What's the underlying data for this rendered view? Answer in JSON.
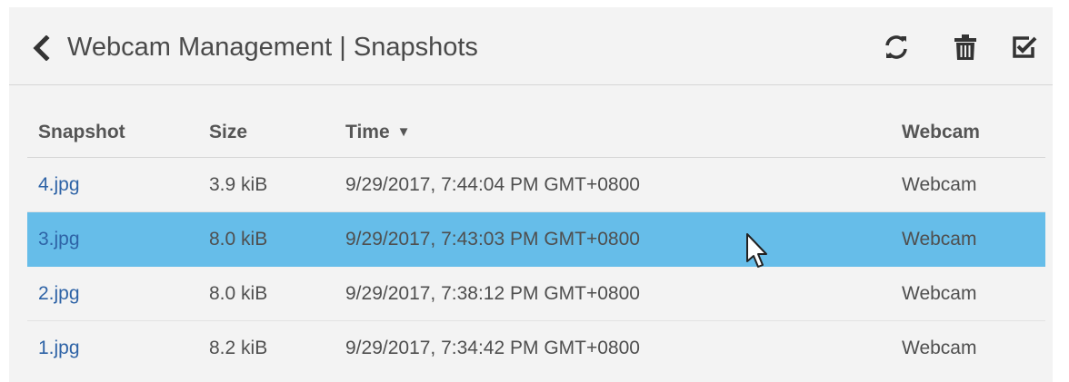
{
  "header": {
    "title": "Webcam Management | Snapshots",
    "back_icon": "chevron-left-icon",
    "actions": [
      {
        "name": "refresh-icon"
      },
      {
        "name": "trash-icon"
      },
      {
        "name": "select-check-icon"
      }
    ]
  },
  "table": {
    "columns": [
      "Snapshot",
      "Size",
      "Time",
      "Webcam"
    ],
    "sort_indicator": "▼",
    "rows": [
      {
        "snapshot": "4.jpg",
        "size": "3.9 kiB",
        "time": "9/29/2017, 7:44:04 PM GMT+0800",
        "webcam": "Webcam",
        "selected": false
      },
      {
        "snapshot": "3.jpg",
        "size": "8.0 kiB",
        "time": "9/29/2017, 7:43:03 PM GMT+0800",
        "webcam": "Webcam",
        "selected": true
      },
      {
        "snapshot": "2.jpg",
        "size": "8.0 kiB",
        "time": "9/29/2017, 7:38:12 PM GMT+0800",
        "webcam": "Webcam",
        "selected": false
      },
      {
        "snapshot": "1.jpg",
        "size": "8.2 kiB",
        "time": "9/29/2017, 7:34:42 PM GMT+0800",
        "webcam": "Webcam",
        "selected": false
      }
    ]
  },
  "colors": {
    "selected_row": "#66bde9",
    "link": "#2e63a6",
    "panel_bg": "#f3f3f3"
  }
}
